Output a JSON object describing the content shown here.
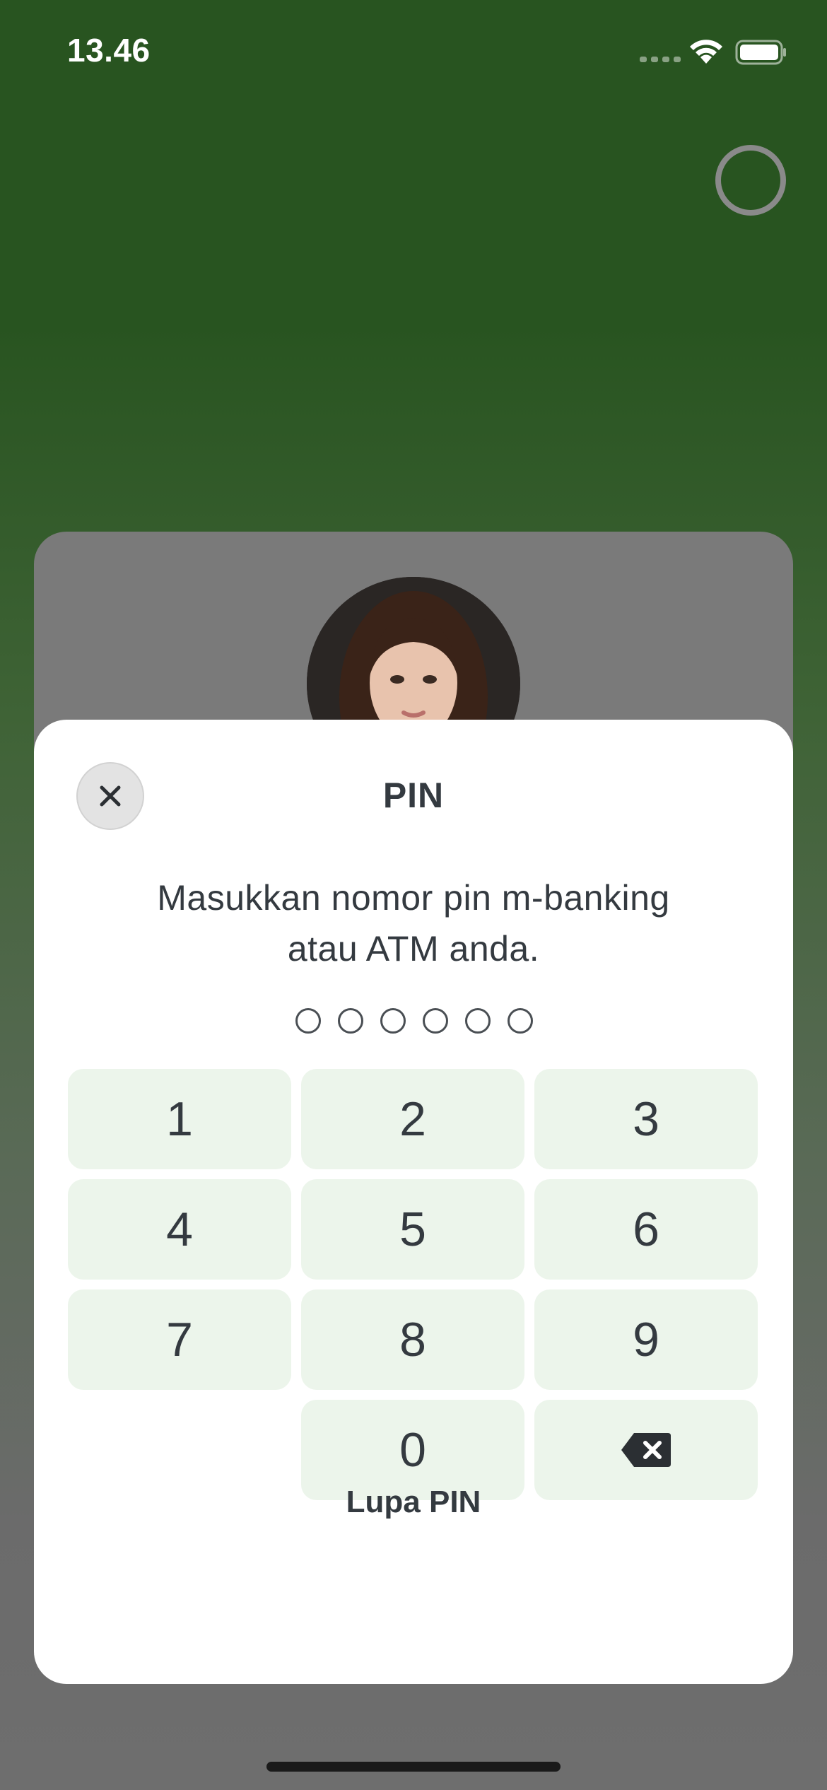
{
  "status_bar": {
    "time": "13.46",
    "wifi_icon": "wifi-icon",
    "battery_icon": "battery-icon"
  },
  "loading_indicator": "loading-ring",
  "profile": {
    "avatar_icon": "avatar"
  },
  "pin_sheet": {
    "title": "PIN",
    "close_icon": "close-icon",
    "instruction_line1": "Masukkan nomor pin m-banking",
    "instruction_line2": "atau ATM anda.",
    "pin_length": 6,
    "pin_filled": 0,
    "keys": [
      "1",
      "2",
      "3",
      "4",
      "5",
      "6",
      "7",
      "8",
      "9",
      "0"
    ],
    "backspace_icon": "backspace-icon",
    "forgot_pin": "Lupa PIN"
  },
  "colors": {
    "header_green": "#285420",
    "key_background": "#ecf5eb",
    "text_dark": "#343a40"
  }
}
